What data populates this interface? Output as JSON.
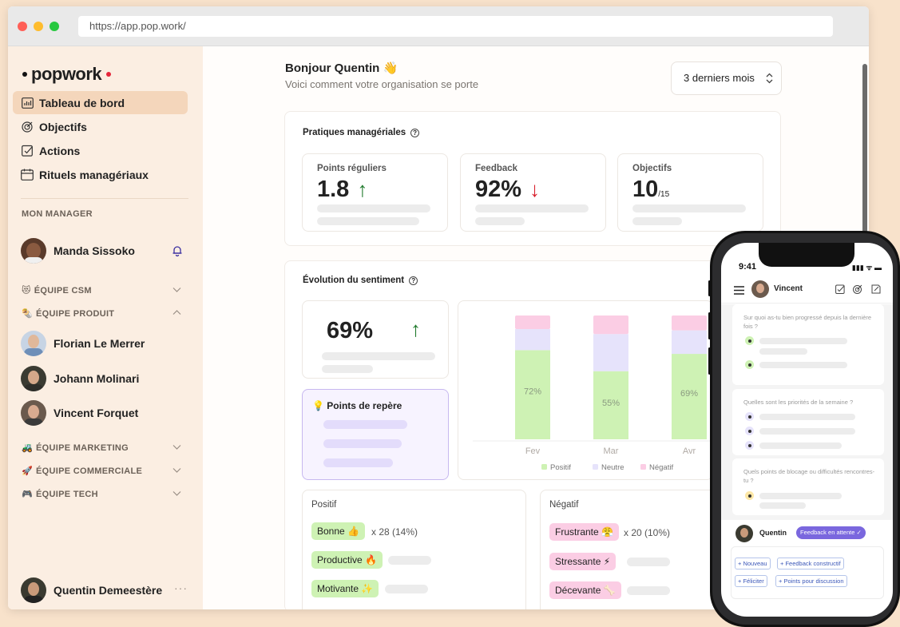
{
  "browser": {
    "url": "https://app.pop.work/"
  },
  "brand": {
    "name": "popwork"
  },
  "sidebar": {
    "nav": [
      {
        "label": "Tableau de bord",
        "icon": "chart-board-icon",
        "active": true
      },
      {
        "label": "Objectifs",
        "icon": "target-icon"
      },
      {
        "label": "Actions",
        "icon": "checkbox-icon"
      },
      {
        "label": "Rituels managériaux",
        "icon": "calendar-icon"
      }
    ],
    "manager_section": "MON MANAGER",
    "manager": {
      "name": "Manda Sissoko"
    },
    "teams": [
      {
        "emoji": "😻",
        "label": "ÉQUIPE CSM",
        "expanded": false
      },
      {
        "emoji": "🌯",
        "label": "ÉQUIPE PRODUIT",
        "expanded": true
      },
      {
        "emoji": "🚜",
        "label": "ÉQUIPE MARKETING",
        "expanded": false
      },
      {
        "emoji": "🚀",
        "label": "ÉQUIPE COMMERCIALE",
        "expanded": false
      },
      {
        "emoji": "🎮",
        "label": "ÉQUIPE TECH",
        "expanded": false
      }
    ],
    "team_members": [
      "Florian Le Merrer",
      "Johann Molinari",
      "Vincent Forquet"
    ],
    "current_user": {
      "name": "Quentin Demeestère",
      "more": "···"
    }
  },
  "main": {
    "greeting": "Bonjour Quentin 👋",
    "subtitle": "Voici comment votre organisation se porte",
    "period": "3 derniers mois",
    "practices": {
      "title": "Pratiques managériales",
      "kpis": [
        {
          "label": "Points réguliers",
          "value": "1.8",
          "trend": "↑"
        },
        {
          "label": "Feedback",
          "value": "92%",
          "trend": "↓"
        },
        {
          "label": "Objectifs",
          "value": "10",
          "suffix": "/15"
        }
      ]
    },
    "sentiment": {
      "title": "Évolution du sentiment",
      "value": "69%",
      "trend": "↑",
      "reperes_title": "Points de repère"
    },
    "positive": {
      "title": "Positif",
      "tags": [
        {
          "label": "Bonne 👍",
          "count": "x 28 (14%)"
        },
        {
          "label": "Productive 🔥"
        },
        {
          "label": "Motivante ✨"
        }
      ]
    },
    "negative": {
      "title": "Négatif",
      "tags": [
        {
          "label": "Frustrante 😤",
          "count": "x 20 (10%)"
        },
        {
          "label": "Stressante ⚡"
        },
        {
          "label": "Décevante 🦴"
        }
      ]
    }
  },
  "chart_data": {
    "type": "bar",
    "stacked": true,
    "categories": [
      "Fev",
      "Mar",
      "Avr"
    ],
    "series": [
      {
        "name": "Positif",
        "values": [
          72,
          55,
          69
        ],
        "color": "#cef2b4"
      },
      {
        "name": "Neutre",
        "values": [
          17,
          30,
          19
        ],
        "color": "#e6e3fb"
      },
      {
        "name": "Négatif",
        "values": [
          11,
          15,
          12
        ],
        "color": "#fbcde4"
      }
    ],
    "data_labels": [
      "72%",
      "55%",
      "69%"
    ],
    "ylim": [
      0,
      100
    ],
    "legend": "bottom"
  },
  "phone": {
    "time": "9:41",
    "status": "▮▮▮ ᯤ ▬",
    "user": "Vincent",
    "questions": [
      "Sur quoi as-tu bien progressé depuis la dernière fois ?",
      "Quelles sont les priorités de la semaine ?",
      "Quels points de blocage ou difficultés rencontres-tu ?"
    ],
    "footer_name": "Quentin",
    "badge": "Feedback en attente ✓",
    "buttons": [
      "+ Nouveau",
      "+ Feedback constructif",
      "+ Féliciter",
      "+ Points pour discussion"
    ]
  }
}
